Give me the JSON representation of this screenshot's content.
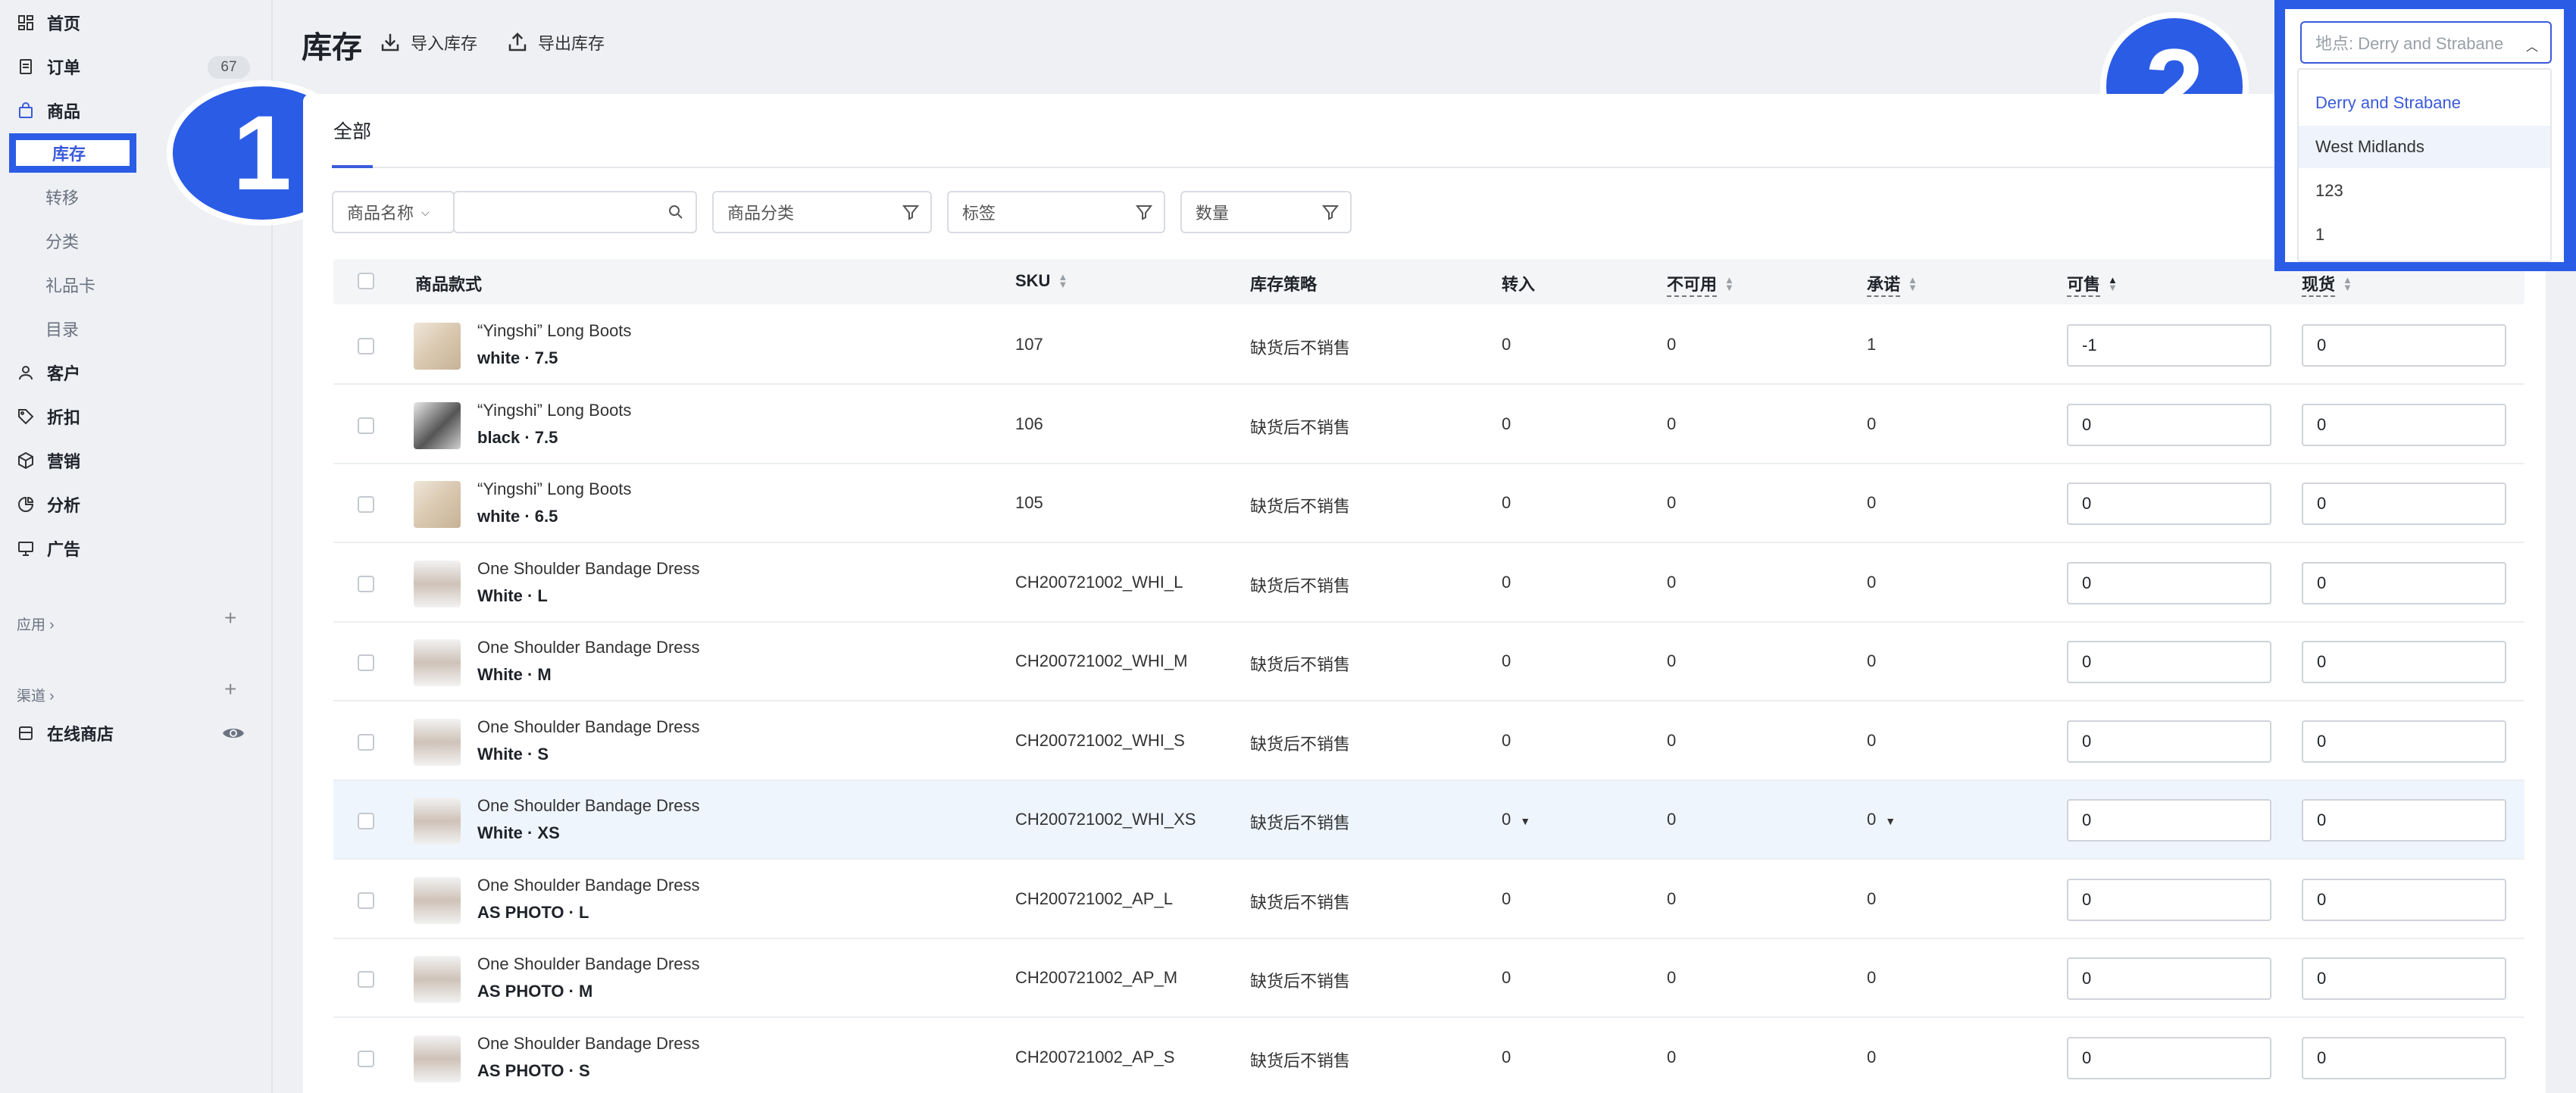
{
  "sidebar": {
    "home": "首页",
    "orders": "订单",
    "orders_count": "67",
    "products": "商品",
    "inventory": "库存",
    "transfer": "转移",
    "category": "分类",
    "giftcard": "礼品卡",
    "catalog": "目录",
    "customers": "客户",
    "discounts": "折扣",
    "marketing": "营销",
    "analytics": "分析",
    "ads": "广告",
    "apps": "应用 ›",
    "channels": "渠道 ›",
    "online_store": "在线商店"
  },
  "annotations": {
    "one": "1",
    "two": "2"
  },
  "header": {
    "title": "库存",
    "import": "导入库存",
    "export": "导出库存"
  },
  "tabs": {
    "all": "全部"
  },
  "filters": {
    "name": "商品名称",
    "category": "商品分类",
    "tags": "标签",
    "quantity": "数量"
  },
  "columns": {
    "product": "商品款式",
    "sku": "SKU",
    "policy": "库存策略",
    "incoming": "转入",
    "unavailable": "不可用",
    "committed": "承诺",
    "available": "可售",
    "on_hand": "现货"
  },
  "rows": [
    {
      "name": "“Yingshi” Long Boots",
      "variant": "white · 7.5",
      "sku": "107",
      "policy": "缺货后不销售",
      "incoming": "0",
      "unavailable": "0",
      "committed": "1",
      "available": "-1",
      "on_hand": "0"
    },
    {
      "name": "“Yingshi” Long Boots",
      "variant": "black · 7.5",
      "sku": "106",
      "policy": "缺货后不销售",
      "incoming": "0",
      "unavailable": "0",
      "committed": "0",
      "available": "0",
      "on_hand": "0"
    },
    {
      "name": "“Yingshi” Long Boots",
      "variant": "white · 6.5",
      "sku": "105",
      "policy": "缺货后不销售",
      "incoming": "0",
      "unavailable": "0",
      "committed": "0",
      "available": "0",
      "on_hand": "0"
    },
    {
      "name": "One Shoulder Bandage Dress",
      "variant": "White · L",
      "sku": "CH200721002_WHI_L",
      "policy": "缺货后不销售",
      "incoming": "0",
      "unavailable": "0",
      "committed": "0",
      "available": "0",
      "on_hand": "0"
    },
    {
      "name": "One Shoulder Bandage Dress",
      "variant": "White · M",
      "sku": "CH200721002_WHI_M",
      "policy": "缺货后不销售",
      "incoming": "0",
      "unavailable": "0",
      "committed": "0",
      "available": "0",
      "on_hand": "0"
    },
    {
      "name": "One Shoulder Bandage Dress",
      "variant": "White · S",
      "sku": "CH200721002_WHI_S",
      "policy": "缺货后不销售",
      "incoming": "0",
      "unavailable": "0",
      "committed": "0",
      "available": "0",
      "on_hand": "0"
    },
    {
      "name": "One Shoulder Bandage Dress",
      "variant": "White · XS",
      "sku": "CH200721002_WHI_XS",
      "policy": "缺货后不销售",
      "incoming": "0",
      "unavailable": "0",
      "committed": "0",
      "available": "0",
      "on_hand": "0"
    },
    {
      "name": "One Shoulder Bandage Dress",
      "variant": "AS PHOTO · L",
      "sku": "CH200721002_AP_L",
      "policy": "缺货后不销售",
      "incoming": "0",
      "unavailable": "0",
      "committed": "0",
      "available": "0",
      "on_hand": "0"
    },
    {
      "name": "One Shoulder Bandage Dress",
      "variant": "AS PHOTO · M",
      "sku": "CH200721002_AP_M",
      "policy": "缺货后不销售",
      "incoming": "0",
      "unavailable": "0",
      "committed": "0",
      "available": "0",
      "on_hand": "0"
    },
    {
      "name": "One Shoulder Bandage Dress",
      "variant": "AS PHOTO · S",
      "sku": "CH200721002_AP_S",
      "policy": "缺货后不销售",
      "incoming": "0",
      "unavailable": "0",
      "committed": "0",
      "available": "0",
      "on_hand": "0"
    }
  ],
  "location": {
    "placeholder": "地点: Derry and Strabane",
    "options": [
      "Derry and Strabane",
      "West Midlands",
      "123",
      "1"
    ]
  },
  "colors": {
    "accent": "#3b5bdb",
    "annotation": "#2b5ce6"
  }
}
